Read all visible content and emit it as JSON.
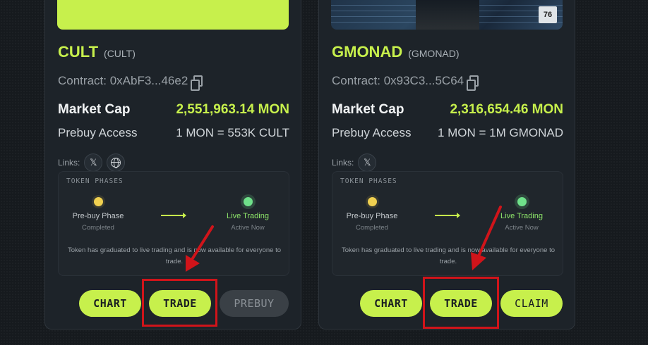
{
  "cards": [
    {
      "name": "CULT",
      "ticker": "(CULT)",
      "contract": "Contract: 0xAbF3...46e2",
      "market_cap_label": "Market Cap",
      "market_cap_value": "2,551,963.14 MON",
      "prebuy_label": "Prebuy Access",
      "prebuy_value": "1 MON = 553K CULT",
      "links_label": "Links:",
      "phases": {
        "title": "TOKEN PHASES",
        "phase1_name": "Pre-buy Phase",
        "phase1_status": "Completed",
        "phase2_name": "Live Trading",
        "phase2_status": "Active Now",
        "description": "Token has graduated to live trading and is now available for everyone to trade."
      },
      "buttons": {
        "chart": "CHART",
        "trade": "TRADE",
        "third": "PREBUY"
      }
    },
    {
      "name": "GMONAD",
      "ticker": "(GMONAD)",
      "contract": "Contract: 0x93C3...5C64",
      "market_cap_label": "Market Cap",
      "market_cap_value": "2,316,654.46 MON",
      "prebuy_label": "Prebuy Access",
      "prebuy_value": "1 MON = 1M GMONAD",
      "links_label": "Links:",
      "banner_tag": "76",
      "phases": {
        "title": "TOKEN PHASES",
        "phase1_name": "Pre-buy Phase",
        "phase1_status": "Completed",
        "phase2_name": "Live Trading",
        "phase2_status": "Active Now",
        "description": "Token has graduated to live trading and is now available for everyone to trade."
      },
      "buttons": {
        "chart": "CHART",
        "trade": "TRADE",
        "third": "CLAIM"
      }
    }
  ],
  "colors": {
    "accent": "#c7f04c",
    "highlight": "#d0141a",
    "card_bg": "#1d2329"
  },
  "icons": [
    "copy-icon",
    "x-icon",
    "globe-icon"
  ]
}
